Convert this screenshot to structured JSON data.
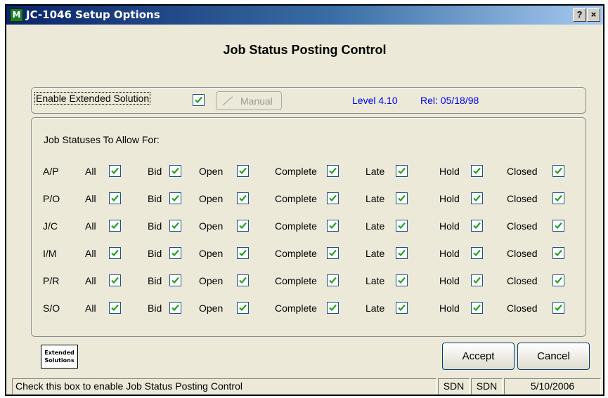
{
  "window": {
    "title": "JC-1046 Setup Options",
    "app_icon": "app-icon",
    "help_button": "?",
    "close_button": "×"
  },
  "heading": "Job Status Posting Control",
  "enable": {
    "label": "Enable Extended Solution",
    "checked": true,
    "manual_button": "Manual",
    "level": "Level 4.10",
    "rel": "Rel: 05/18/98"
  },
  "statuses": {
    "title": "Job Statuses To Allow For:",
    "columns": [
      "All",
      "Bid",
      "Open",
      "Complete",
      "Late",
      "Hold",
      "Closed"
    ],
    "rows": [
      {
        "module": "A/P",
        "checked": [
          true,
          true,
          true,
          true,
          true,
          true,
          true
        ]
      },
      {
        "module": "P/O",
        "checked": [
          true,
          true,
          true,
          true,
          true,
          true,
          true
        ]
      },
      {
        "module": "J/C",
        "checked": [
          true,
          true,
          true,
          true,
          true,
          true,
          true
        ]
      },
      {
        "module": "I/M",
        "checked": [
          true,
          true,
          true,
          true,
          true,
          true,
          true
        ]
      },
      {
        "module": "P/R",
        "checked": [
          true,
          true,
          true,
          true,
          true,
          true,
          true
        ]
      },
      {
        "module": "S/O",
        "checked": [
          true,
          true,
          true,
          true,
          true,
          true,
          true
        ]
      }
    ]
  },
  "logo": {
    "line1": "Extended",
    "line2": "Solutions"
  },
  "buttons": {
    "accept": "Accept",
    "cancel": "Cancel"
  },
  "statusbar": {
    "message": "Check this box to enable Job Status Posting Control",
    "user1": "SDN",
    "user2": "SDN",
    "date": "5/10/2006"
  },
  "colors": {
    "check": "#21a121",
    "link_blue": "#0000ee",
    "title_bar": "#0a246a"
  }
}
